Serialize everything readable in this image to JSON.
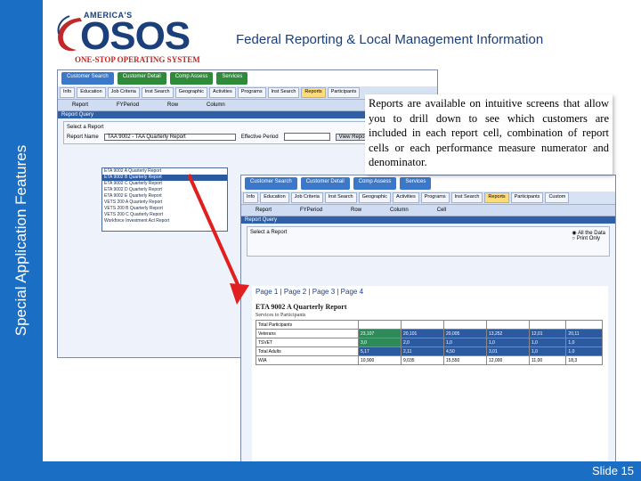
{
  "sidebar": {
    "title": "Special Application Features"
  },
  "logo": {
    "top": "AMERICA'S",
    "main": "OSOS",
    "sub": "ONE-STOP OPERATING SYSTEM"
  },
  "header": {
    "title": "Federal Reporting & Local Management Information"
  },
  "callout": {
    "text": "Reports are available on intuitive screens that allow you to drill down to see which customers are included in each report cell, combination of report cells or each performance measure numerator and denominator."
  },
  "slide": {
    "number": "Slide 15"
  },
  "screenshot1": {
    "nav": [
      "Customer Search",
      "Customer Detail",
      "Comp Assess",
      "Services"
    ],
    "tabs": [
      "Info",
      "Education",
      "Job Criteria",
      "Inst Search",
      "Geographic",
      "Activities",
      "Programs",
      "Inst Search",
      "Reports",
      "Participants"
    ],
    "columns": [
      "Report",
      "FYPeriod",
      "Row",
      "Column"
    ],
    "section": "Report Query",
    "panel_label": "Select a Report",
    "report_name_label": "Report Name",
    "report_name_value": "TAA 9002 - TAA Quarterly Report",
    "period_label": "Effective Period",
    "view_button": "View Report",
    "dropdown_items": [
      "ETA 9002 A Quarterly Report",
      "ETA 9002 B Quarterly Report",
      "ETA 9002 C Quarterly Report",
      "ETA 9002 D Quarterly Report",
      "ETA 9002 E Quarterly Report",
      "VETS 200 A Quarterly Report",
      "VETS 200 B Quarterly Report",
      "VETS 200 C Quarterly Report",
      "Workforce Investment Act Report"
    ]
  },
  "screenshot2": {
    "nav": [
      "Customer Search",
      "Customer Detail",
      "Comp Assess",
      "Services"
    ],
    "tabs": [
      "Info",
      "Education",
      "Job Criteria",
      "Inst Search",
      "Geographic",
      "Activities",
      "Programs",
      "Inst Search",
      "Reports",
      "Participants",
      "Custom"
    ],
    "columns": [
      "Report",
      "FYPeriod",
      "Row",
      "Column",
      "Cell"
    ],
    "section": "Report Query",
    "panel_label": "Select a Report",
    "report_links": [
      "Page 1",
      "Page 2",
      "Page 3",
      "Page 4"
    ],
    "report_title": "ETA 9002 A Quarterly Report",
    "report_subtitle": "Services to Participants",
    "radio_options": [
      "All the Data",
      "Print Only"
    ],
    "rows": [
      {
        "label": "Total Participants",
        "cells": [
          "",
          "",
          "",
          "",
          "",
          "",
          ""
        ]
      },
      {
        "label": "Veterans",
        "cells": [
          "23,107",
          "20,101",
          "20,005",
          "13,252",
          "12,01",
          "20,11",
          ""
        ]
      },
      {
        "label": "TSVET",
        "cells": [
          "3,0",
          "2,0",
          "1,0",
          "1,0",
          "1,0",
          "1,0",
          ""
        ]
      },
      {
        "label": "Total Adults",
        "cells": [
          "5,17",
          "2,11",
          "4,50",
          "3,01",
          "1,0",
          "1,0",
          ""
        ]
      },
      {
        "label": "WIA",
        "cells": [
          "10,900",
          "9,035",
          "15,550",
          "12,000",
          "11,00",
          "18,3",
          ""
        ]
      }
    ]
  },
  "colors": {
    "brand": "#1a6fc4",
    "logo_blue": "#1a3f7a",
    "logo_red": "#c0282a",
    "arrow": "#e02020"
  }
}
